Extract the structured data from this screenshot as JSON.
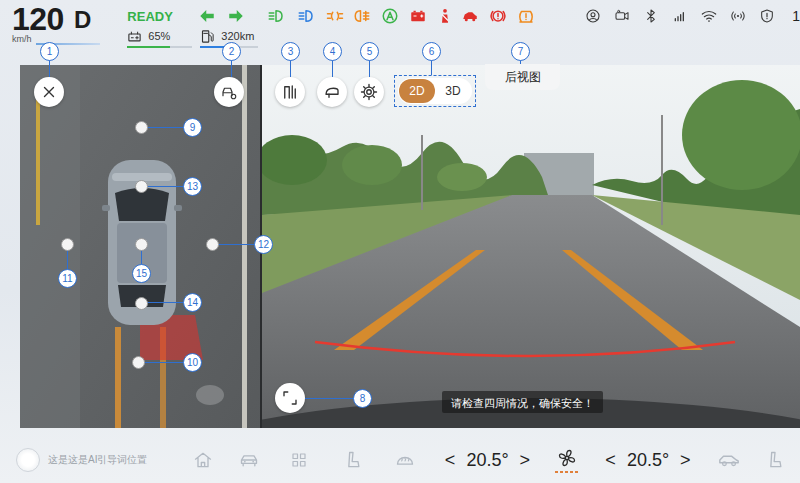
{
  "status_bar": {
    "speed": "120",
    "speed_unit": "km/h",
    "gear": "D",
    "ready": "READY",
    "battery": "65%",
    "battery_level": 0.65,
    "range": "320km",
    "range_level": 0.5,
    "clock_partial": "1"
  },
  "camera": {
    "view_label": "后视图",
    "modes": [
      {
        "label": "2D",
        "selected": true
      },
      {
        "label": "3D",
        "selected": false
      }
    ],
    "toast": "请检查四周情况，确保安全！"
  },
  "callouts": [
    {
      "label": "1"
    },
    {
      "label": "2"
    },
    {
      "label": "3"
    },
    {
      "label": "4"
    },
    {
      "label": "5"
    },
    {
      "label": "6"
    },
    {
      "label": "7"
    },
    {
      "label": "8"
    },
    {
      "label": "9"
    },
    {
      "label": "10"
    },
    {
      "label": "11"
    },
    {
      "label": "12"
    },
    {
      "label": "13"
    },
    {
      "label": "14"
    },
    {
      "label": "15"
    }
  ],
  "bottom_bar": {
    "ai_hint": "这是这是AI引导词位置",
    "temp_left": {
      "dec": "<",
      "value": "20.5°",
      "inc": ">"
    },
    "temp_right": {
      "dec": "<",
      "value": "20.5°",
      "inc": ">"
    }
  }
}
